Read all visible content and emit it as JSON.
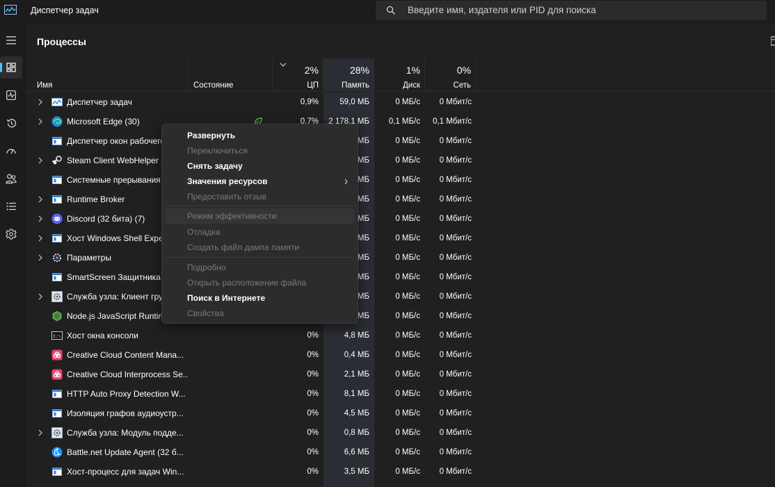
{
  "window": {
    "title": "Диспетчер задач",
    "search_placeholder": "Введите имя, издателя или PID для поиска"
  },
  "sidebar": {
    "items": [
      {
        "icon": "hamburger-menu-icon"
      },
      {
        "icon": "processes-icon",
        "active": true
      },
      {
        "icon": "performance-icon"
      },
      {
        "icon": "app-history-icon"
      },
      {
        "icon": "startup-apps-icon"
      },
      {
        "icon": "users-icon"
      },
      {
        "icon": "details-icon"
      },
      {
        "icon": "services-icon"
      }
    ]
  },
  "page": {
    "title": "Процессы"
  },
  "columns": {
    "name": "Имя",
    "status": "Состояние",
    "cpu": {
      "pct": "2%",
      "label": "ЦП"
    },
    "mem": {
      "pct": "28%",
      "label": "Память"
    },
    "disk": {
      "pct": "1%",
      "label": "Диск"
    },
    "net": {
      "pct": "0%",
      "label": "Сеть"
    }
  },
  "processes": [
    {
      "name": "Диспетчер задач",
      "cpu": "0,9%",
      "mem": "59,0 МБ",
      "disk": "0 МБ/с",
      "net": "0 Мбит/с"
    },
    {
      "name": "Microsoft Edge (30)",
      "cpu": "0,7%",
      "mem": "2 178,1 МБ",
      "disk": "0,1 МБ/с",
      "net": "0,1 Мбит/с"
    },
    {
      "name": "Диспетчер окон рабочего стола",
      "cpu": "",
      "mem": "МБ",
      "disk": "0 МБ/с",
      "net": "0 Мбит/с"
    },
    {
      "name": "Steam Client WebHelper (7)",
      "cpu": "",
      "mem": "МБ",
      "disk": "0 МБ/с",
      "net": "0 Мбит/с"
    },
    {
      "name": "Системные прерывания",
      "cpu": "",
      "mem": "МБ",
      "disk": "0 МБ/с",
      "net": "0 Мбит/с"
    },
    {
      "name": "Runtime Broker",
      "cpu": "",
      "mem": "МБ",
      "disk": "0 МБ/с",
      "net": "0 Мбит/с"
    },
    {
      "name": "Discord (32 бита) (7)",
      "cpu": "",
      "mem": "МБ",
      "disk": "0 МБ/с",
      "net": "0 Мбит/с"
    },
    {
      "name": "Хост Windows Shell Experience",
      "cpu": "",
      "mem": "МБ",
      "disk": "0 МБ/с",
      "net": "0 Мбит/с"
    },
    {
      "name": "Параметры",
      "cpu": "",
      "mem": "МБ",
      "disk": "0 МБ/с",
      "net": "0 Мбит/с"
    },
    {
      "name": "SmartScreen Защитника Windows",
      "cpu": "",
      "mem": "МБ",
      "disk": "0 МБ/с",
      "net": "0 Мбит/с"
    },
    {
      "name": "Служба узла: Клиент групповой политики",
      "cpu": "",
      "mem": "МБ",
      "disk": "0 МБ/с",
      "net": "0 Мбит/с"
    },
    {
      "name": "Node.js JavaScript Runtime",
      "cpu": "",
      "mem": "МБ",
      "disk": "0 МБ/с",
      "net": "0 Мбит/с"
    },
    {
      "name": "Хост окна консоли",
      "cpu": "0%",
      "mem": "4,8 МБ",
      "disk": "0 МБ/с",
      "net": "0 Мбит/с"
    },
    {
      "name": "Creative Cloud Content Mana...",
      "cpu": "0%",
      "mem": "0,4 МБ",
      "disk": "0 МБ/с",
      "net": "0 Мбит/с"
    },
    {
      "name": "Creative Cloud Interprocess Se...",
      "cpu": "0%",
      "mem": "2,1 МБ",
      "disk": "0 МБ/с",
      "net": "0 Мбит/с"
    },
    {
      "name": "HTTP Auto Proxy Detection W...",
      "cpu": "0%",
      "mem": "8,1 МБ",
      "disk": "0 МБ/с",
      "net": "0 Мбит/с"
    },
    {
      "name": "Изоляция графов аудиоустр...",
      "cpu": "0%",
      "mem": "4,5 МБ",
      "disk": "0 МБ/с",
      "net": "0 Мбит/с"
    },
    {
      "name": "Служба узла: Модуль подде...",
      "cpu": "0%",
      "mem": "0,8 МБ",
      "disk": "0 МБ/с",
      "net": "0 Мбит/с"
    },
    {
      "name": "Battle.net Update Agent (32 б...",
      "cpu": "0%",
      "mem": "6,6 МБ",
      "disk": "0 МБ/с",
      "net": "0 Мбит/с"
    },
    {
      "name": "Хост-процесс для задач Win...",
      "cpu": "0%",
      "mem": "3,5 МБ",
      "disk": "0 МБ/с",
      "net": "0 Мбит/с"
    }
  ],
  "context_menu": {
    "items": [
      {
        "label": "Развернуть"
      },
      {
        "label": "Переключиться"
      },
      {
        "label": "Снять задачу"
      },
      {
        "label": "Значения ресурсов"
      },
      {
        "label": "Предоставить отзыв"
      },
      {
        "label": "Режим эффективности"
      },
      {
        "label": "Отладка"
      },
      {
        "label": "Создать файл дампа памяти"
      },
      {
        "label": "Подробно"
      },
      {
        "label": "Открыть расположение файла"
      },
      {
        "label": "Поиск в Интернете"
      },
      {
        "label": "Свойства"
      }
    ]
  },
  "colors": {
    "background": "#202020",
    "titlebar": "#1c1c1c",
    "accent": "#4cc2ff",
    "memory_highlight": "#2a2d33",
    "menu_bg": "#2c2c2c"
  }
}
